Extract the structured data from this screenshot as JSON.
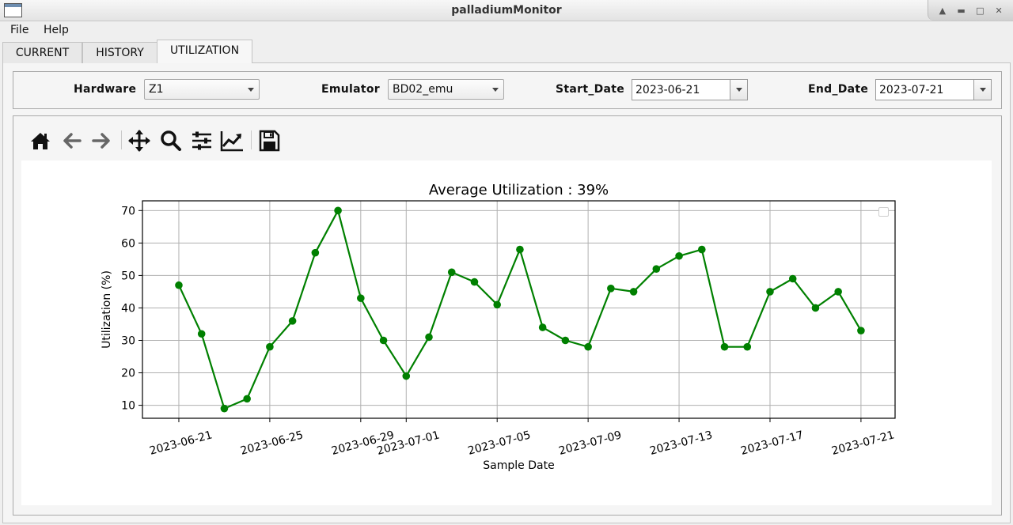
{
  "window": {
    "title": "palladiumMonitor",
    "controls": [
      "up-icon",
      "minimize-icon",
      "maximize-icon",
      "close-icon"
    ]
  },
  "menu": [
    "File",
    "Help"
  ],
  "tabs": [
    {
      "label": "CURRENT",
      "active": false
    },
    {
      "label": "HISTORY",
      "active": false
    },
    {
      "label": "UTILIZATION",
      "active": true
    }
  ],
  "filters": {
    "hardware_label": "Hardware",
    "hardware_value": "Z1",
    "emulator_label": "Emulator",
    "emulator_value": "BD02_emu",
    "start_label": "Start_Date",
    "start_value": "2023-06-21",
    "end_label": "End_Date",
    "end_value": "2023-07-21"
  },
  "toolbar": [
    "home-icon",
    "back-icon",
    "forward-icon",
    "pan-icon",
    "zoom-icon",
    "configure-subplots-icon",
    "edit-axis-icon",
    "save-icon"
  ],
  "chart_data": {
    "type": "line",
    "title": "Average Utilization : 39%",
    "xlabel": "Sample Date",
    "ylabel": "Utilization (%)",
    "line_color": "#008000",
    "grid": true,
    "legend": "top-right (empty)",
    "ylim": [
      6,
      73
    ],
    "xlim": [
      "2023-06-19.4",
      "2023-07-22.5"
    ],
    "y_ticks": [
      10,
      20,
      30,
      40,
      50,
      60,
      70
    ],
    "x_ticks": [
      "2023-06-21",
      "2023-06-25",
      "2023-06-29",
      "2023-07-01",
      "2023-07-05",
      "2023-07-09",
      "2023-07-13",
      "2023-07-17",
      "2023-07-21"
    ],
    "x": [
      "2023-06-21",
      "2023-06-22",
      "2023-06-23",
      "2023-06-24",
      "2023-06-25",
      "2023-06-26",
      "2023-06-27",
      "2023-06-28",
      "2023-06-29",
      "2023-06-30",
      "2023-07-01",
      "2023-07-02",
      "2023-07-03",
      "2023-07-04",
      "2023-07-05",
      "2023-07-06",
      "2023-07-07",
      "2023-07-08",
      "2023-07-09",
      "2023-07-10",
      "2023-07-11",
      "2023-07-12",
      "2023-07-13",
      "2023-07-14",
      "2023-07-15",
      "2023-07-16",
      "2023-07-17",
      "2023-07-18",
      "2023-07-19",
      "2023-07-20",
      "2023-07-21"
    ],
    "y": [
      47,
      32,
      9,
      12,
      28,
      36,
      57,
      70,
      43,
      30,
      19,
      31,
      51,
      48,
      41,
      58,
      34,
      30,
      28,
      46,
      45,
      52,
      56,
      58,
      28,
      28,
      45,
      49,
      40,
      45,
      33
    ]
  }
}
